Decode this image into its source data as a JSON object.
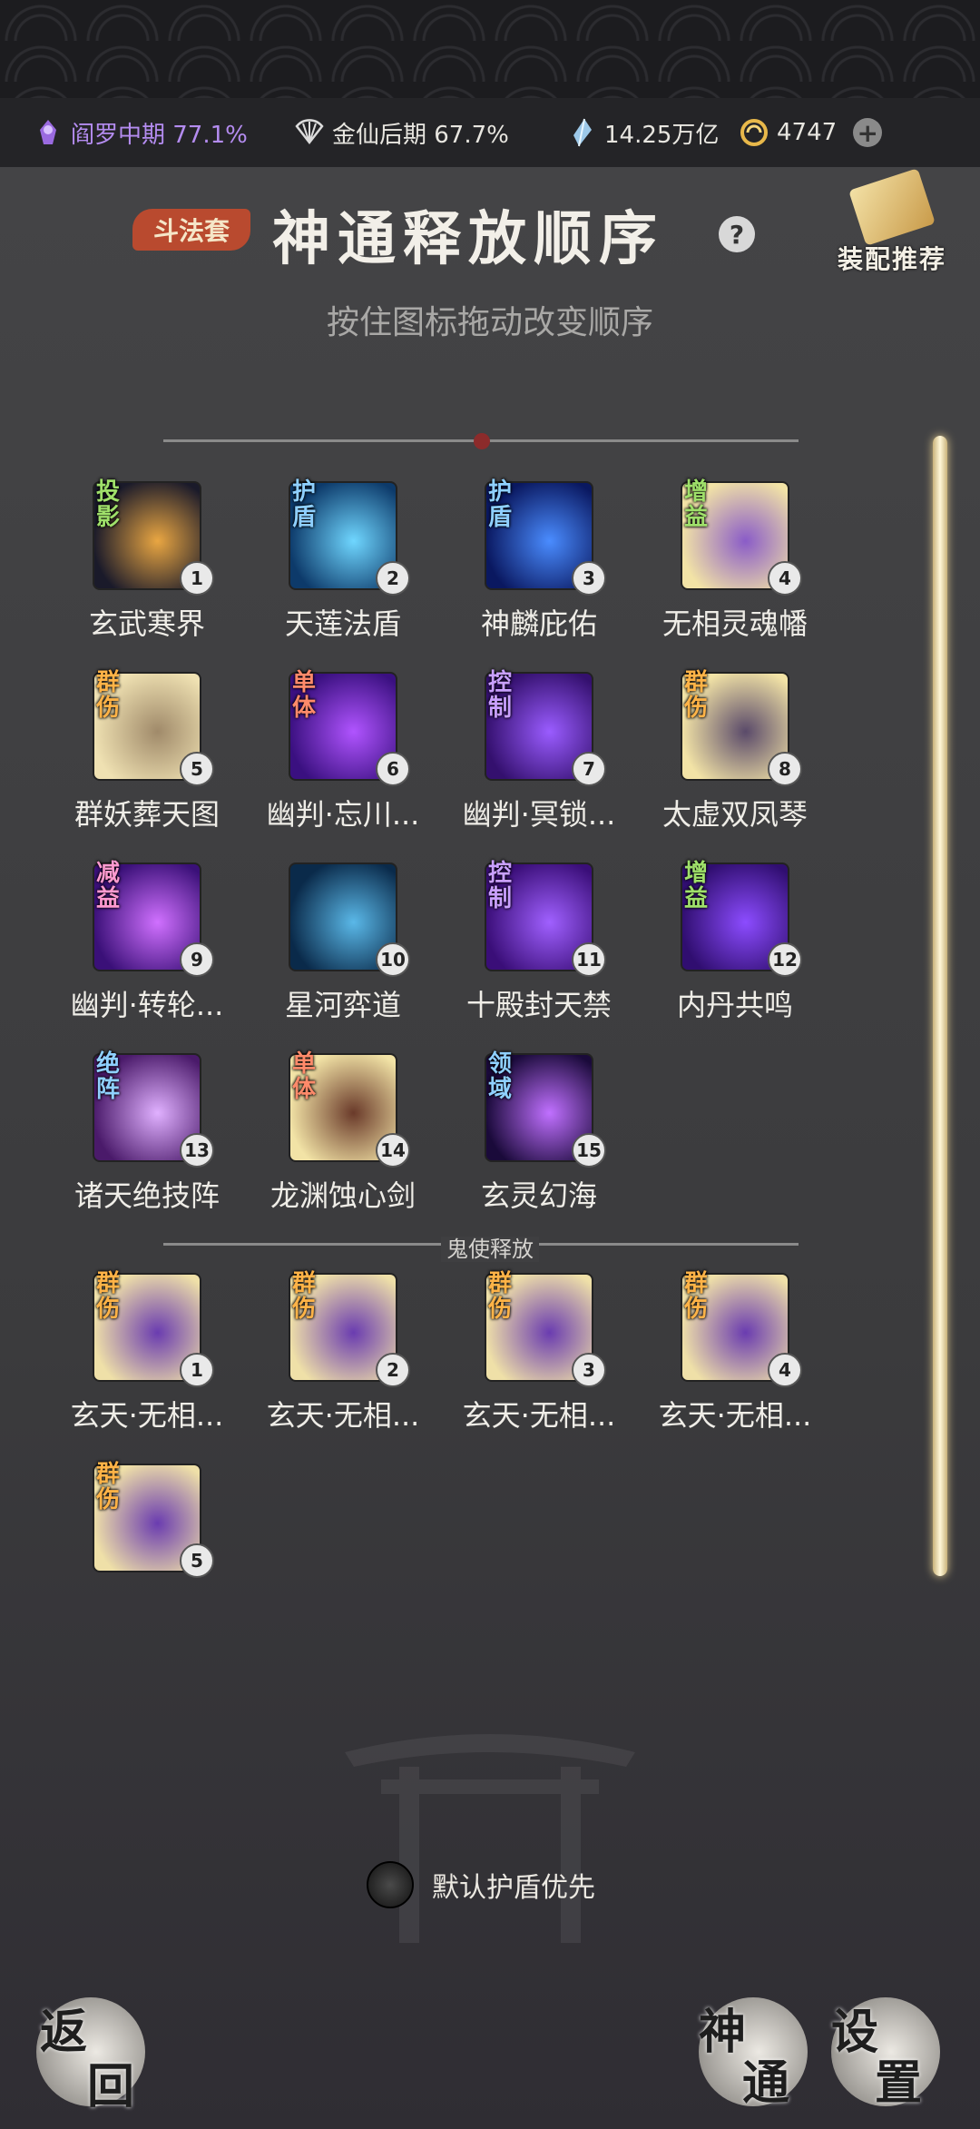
{
  "resources": {
    "realm1": "阎罗中期 77.1%",
    "realm2": "金仙后期 67.7%",
    "spirit_stones": "14.25万亿",
    "gold": "4747"
  },
  "header": {
    "set_badge": "斗法套",
    "title": "神通释放顺序",
    "help": "?",
    "recommend_label": "装配推荐",
    "subtitle": "按住图标拖动改变顺序"
  },
  "skills": [
    {
      "tag": "投影",
      "tag_color": "#9fe06a",
      "num": "1",
      "name": "玄武寒界",
      "palette": [
        "#1a1a2a",
        "#e9a642"
      ]
    },
    {
      "tag": "护盾",
      "tag_color": "#8fd0ff",
      "num": "2",
      "name": "天莲法盾",
      "palette": [
        "#0d3a6a",
        "#6fd6ff"
      ]
    },
    {
      "tag": "护盾",
      "tag_color": "#8fd0ff",
      "num": "3",
      "name": "神麟庇佑",
      "palette": [
        "#0a1860",
        "#4a8cff"
      ]
    },
    {
      "tag": "增益",
      "tag_color": "#9fe06a",
      "num": "4",
      "name": "无相灵魂幡",
      "palette": [
        "#f2e3a6",
        "#8a5cc8"
      ]
    },
    {
      "tag": "群伤",
      "tag_color": "#ffb347",
      "num": "5",
      "name": "群妖葬天图",
      "palette": [
        "#efe1b2",
        "#a08a6a"
      ]
    },
    {
      "tag": "单体",
      "tag_color": "#ff8a6a",
      "num": "6",
      "name": "幽判·忘川...",
      "palette": [
        "#3a1080",
        "#b054ff"
      ]
    },
    {
      "tag": "控制",
      "tag_color": "#c9a0ff",
      "num": "7",
      "name": "幽判·冥锁...",
      "palette": [
        "#34106e",
        "#9a5cff"
      ]
    },
    {
      "tag": "群伤",
      "tag_color": "#ffb347",
      "num": "8",
      "name": "太虚双凤琴",
      "palette": [
        "#f2e3a6",
        "#5a4a6a"
      ]
    },
    {
      "tag": "减益",
      "tag_color": "#ff9ad0",
      "num": "9",
      "name": "幽判·转轮...",
      "palette": [
        "#3a1078",
        "#d070ff"
      ]
    },
    {
      "tag": "",
      "tag_color": "#ffffff",
      "num": "10",
      "name": "星河弈道",
      "palette": [
        "#0a2a4a",
        "#5ab8e8"
      ]
    },
    {
      "tag": "控制",
      "tag_color": "#c9a0ff",
      "num": "11",
      "name": "十殿封天禁",
      "palette": [
        "#3a0e78",
        "#a060ff"
      ]
    },
    {
      "tag": "增益",
      "tag_color": "#9fe06a",
      "num": "12",
      "name": "内丹共鸣",
      "palette": [
        "#300e70",
        "#8c4cff"
      ]
    },
    {
      "tag": "绝阵",
      "tag_color": "#8fd0ff",
      "num": "13",
      "name": "诸天绝技阵",
      "palette": [
        "#4a1a6a",
        "#e0b0ff"
      ]
    },
    {
      "tag": "单体",
      "tag_color": "#ff8a6a",
      "num": "14",
      "name": "龙渊蚀心剑",
      "palette": [
        "#f2e3a6",
        "#6a3a2a"
      ]
    },
    {
      "tag": "领域",
      "tag_color": "#8fd0ff",
      "num": "15",
      "name": "玄灵幻海",
      "palette": [
        "#1a0a3a",
        "#c070ff"
      ]
    }
  ],
  "ghost_section_label": "鬼使释放",
  "ghost_skills": [
    {
      "tag": "群伤",
      "tag_color": "#ffb347",
      "num": "1",
      "name": "玄天·无相..."
    },
    {
      "tag": "群伤",
      "tag_color": "#ffb347",
      "num": "2",
      "name": "玄天·无相..."
    },
    {
      "tag": "群伤",
      "tag_color": "#ffb347",
      "num": "3",
      "name": "玄天·无相..."
    },
    {
      "tag": "群伤",
      "tag_color": "#ffb347",
      "num": "4",
      "name": "玄天·无相..."
    },
    {
      "tag": "群伤",
      "tag_color": "#ffb347",
      "num": "5",
      "name": ""
    }
  ],
  "shield_toggle": "默认护盾优先",
  "bottom": {
    "back": [
      "返",
      "回"
    ],
    "shentong": [
      "神",
      "通"
    ],
    "settings": [
      "设",
      "置"
    ]
  },
  "colors": {
    "realm1": "#b48cf0",
    "realm2": "#e8e6e0"
  }
}
